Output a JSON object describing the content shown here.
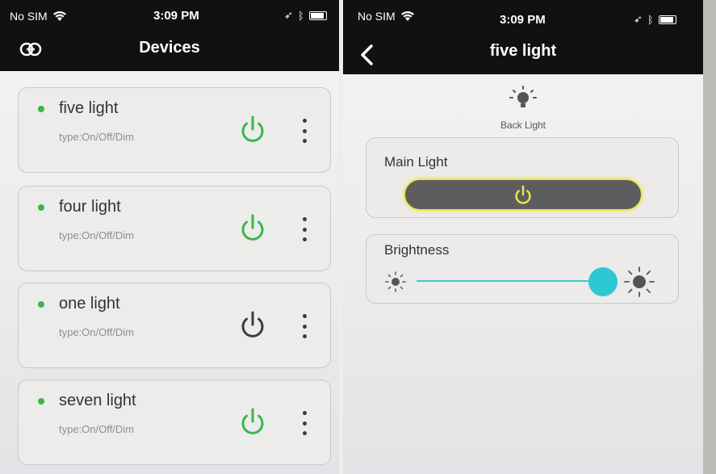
{
  "status_bar": {
    "carrier": "No SIM",
    "time": "3:09 PM"
  },
  "devices_screen": {
    "title": "Devices",
    "devices": [
      {
        "name": "five light",
        "type": "type:On/Off/Dim",
        "power_color": "#3ab54a"
      },
      {
        "name": "four light",
        "type": "type:On/Off/Dim",
        "power_color": "#3ab54a"
      },
      {
        "name": "one light",
        "type": "type:On/Off/Dim",
        "power_color": "#3c3c3c"
      },
      {
        "name": "seven light",
        "type": "type:On/Off/Dim",
        "power_color": "#3ab54a"
      }
    ]
  },
  "detail_screen": {
    "title": "five light",
    "back_light_label": "Back Light",
    "main_light_label": "Main Light",
    "brightness_label": "Brightness",
    "brightness_level": 1.0
  },
  "colors": {
    "on_green": "#3ab54a",
    "accent_cyan": "#2ec7d4",
    "power_yellow": "#e9e64d"
  }
}
